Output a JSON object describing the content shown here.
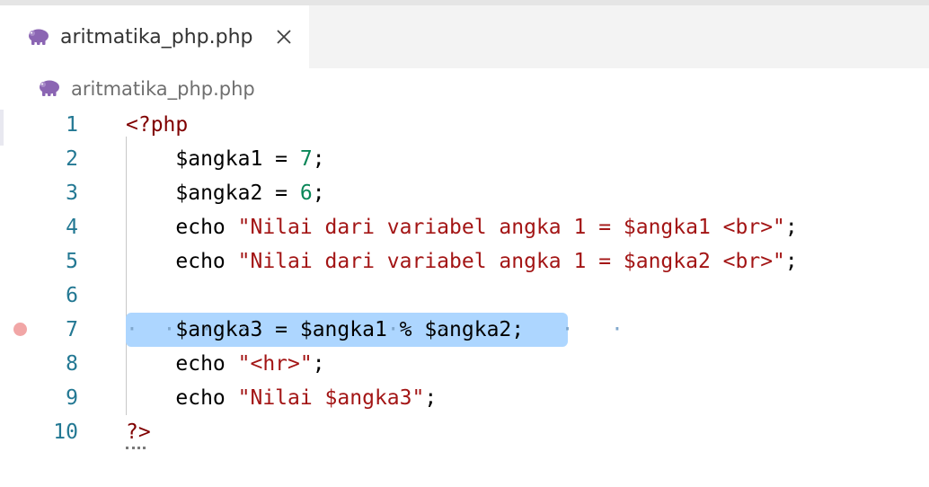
{
  "tab": {
    "filename": "aritmatika_php.php"
  },
  "breadcrumb": {
    "filename": "aritmatika_php.php"
  },
  "icons": {
    "file": "php-elephant-icon",
    "close": "close-icon"
  },
  "colors": {
    "line_number": "#237893",
    "keyword": "#800000",
    "number": "#098658",
    "string": "#a31515",
    "selection": "#add6ff",
    "breakpoint": "#f1a6a6"
  },
  "lines": [
    {
      "n": "1",
      "parts": [
        {
          "t": "<?php",
          "c": "kw"
        }
      ]
    },
    {
      "n": "2",
      "parts": [
        {
          "t": "    $angka1 = ",
          "c": "plain"
        },
        {
          "t": "7",
          "c": "num"
        },
        {
          "t": ";",
          "c": "plain"
        }
      ]
    },
    {
      "n": "3",
      "parts": [
        {
          "t": "    $angka2 = ",
          "c": "plain"
        },
        {
          "t": "6",
          "c": "num"
        },
        {
          "t": ";",
          "c": "plain"
        }
      ]
    },
    {
      "n": "4",
      "parts": [
        {
          "t": "    echo ",
          "c": "plain"
        },
        {
          "t": "\"Nilai dari variabel angka 1 = $angka1 <br>\"",
          "c": "str"
        },
        {
          "t": ";",
          "c": "plain"
        }
      ]
    },
    {
      "n": "5",
      "parts": [
        {
          "t": "    echo ",
          "c": "plain"
        },
        {
          "t": "\"Nilai dari variabel angka 1 = $angka2 <br>\"",
          "c": "str"
        },
        {
          "t": ";",
          "c": "plain"
        }
      ]
    },
    {
      "n": "6",
      "parts": []
    },
    {
      "n": "7",
      "parts": [
        {
          "t": "    $angka3 = $angka1 % $angka2;",
          "c": "plain"
        }
      ]
    },
    {
      "n": "8",
      "parts": [
        {
          "t": "    echo ",
          "c": "plain"
        },
        {
          "t": "\"<hr>\"",
          "c": "str"
        },
        {
          "t": ";",
          "c": "plain"
        }
      ]
    },
    {
      "n": "9",
      "parts": [
        {
          "t": "    echo ",
          "c": "plain"
        },
        {
          "t": "\"Nilai $angka3\"",
          "c": "str"
        },
        {
          "t": ";",
          "c": "plain"
        }
      ]
    },
    {
      "n": "10",
      "parts": [
        {
          "t": "?>",
          "c": "kw"
        }
      ]
    }
  ]
}
